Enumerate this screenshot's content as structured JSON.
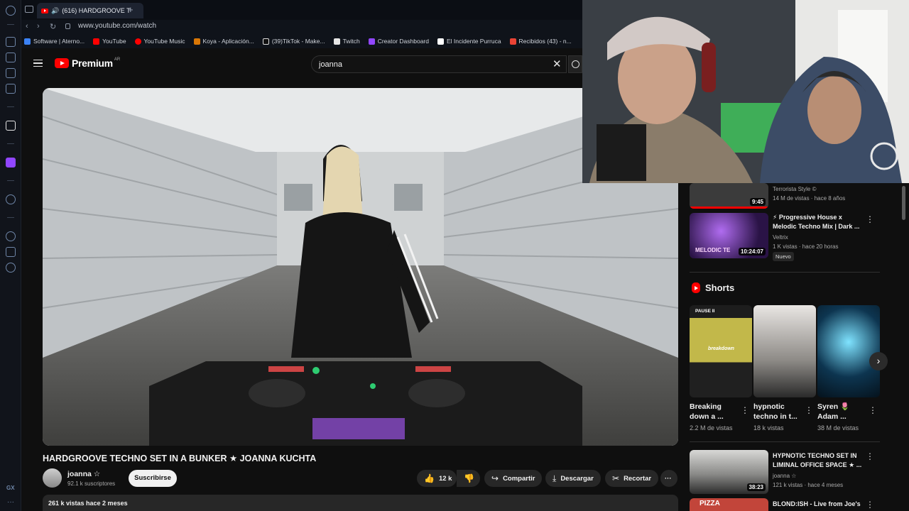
{
  "browser": {
    "tab_title": "(616) HARDGROOVE T",
    "new_tab_symbol": "+",
    "url": "www.youtube.com/watch",
    "bookmarks": [
      {
        "label": "Software | Aterno..."
      },
      {
        "label": "YouTube"
      },
      {
        "label": "YouTube Music"
      },
      {
        "label": "Koya - Aplicación..."
      },
      {
        "label": "(39)TikTok - Make..."
      },
      {
        "label": "Twitch"
      },
      {
        "label": "Creator Dashboard"
      },
      {
        "label": "El Incidente Purruca"
      },
      {
        "label": "Recibidos (43) - n..."
      }
    ],
    "sidebar_footer": "GX"
  },
  "youtube": {
    "logo_text": "Premium",
    "region": "AR",
    "search_value": "joanna"
  },
  "video": {
    "title": "HARDGROOVE TECHNO SET IN A BUNKER ★ JOANNA KUCHTA",
    "channel": "joanna ☆",
    "subscribers": "92.1 k suscriptores",
    "subscribe_label": "Suscribirse",
    "likes": "12 k",
    "share_label": "Compartir",
    "download_label": "Descargar",
    "clip_label": "Recortar",
    "more_label": "···",
    "views_date": "261 k vistas  hace 2 meses"
  },
  "recommendations": [
    {
      "title": "",
      "channel": "Terrorista Style ©",
      "meta": "14 M de vistas · hace 8 años",
      "duration": "9:45"
    },
    {
      "title": "⚡ Progressive House x Melodic Techno Mix | Dark ...",
      "channel": "Veltrix",
      "meta": "1 K vistas · hace 20 horas",
      "duration": "10:24:07",
      "badge": "Nuevo",
      "thumb_text": "MELODIC TE"
    }
  ],
  "shorts": {
    "heading": "Shorts",
    "items": [
      {
        "title": "Breaking down a ...",
        "views": "2.2 M de vistas",
        "overlay": "PAUSE II",
        "caption": "breakdown"
      },
      {
        "title": "hypnotic techno in t...",
        "views": "18 k vistas"
      },
      {
        "title": "Syren 🌷 Adam ...",
        "views": "38 M de vistas"
      }
    ]
  },
  "recommendations_lower": [
    {
      "title": "HYPNOTIC TECHNO SET IN LIMINAL OFFICE SPACE ★ ...",
      "channel": "joanna ☆",
      "meta": "121 k vistas · hace 4 meses",
      "duration": "38:23"
    },
    {
      "title": "BLOND:ISH - Live from Joe's",
      "thumb_text": "PIZZA"
    }
  ]
}
